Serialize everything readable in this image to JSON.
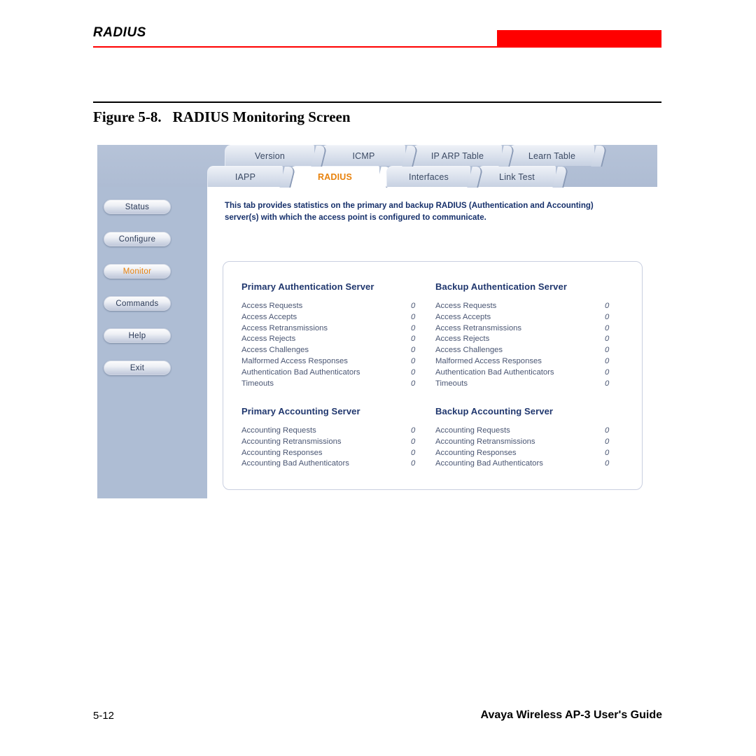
{
  "header": {
    "title": "RADIUS",
    "accent_color": "#ff0000"
  },
  "caption": {
    "figure_number": "Figure 5-8.",
    "figure_title": "RADIUS Monitoring Screen"
  },
  "screenshot": {
    "tabs_top": [
      {
        "label": "Version",
        "active": false
      },
      {
        "label": "ICMP",
        "active": false
      },
      {
        "label": "IP ARP Table",
        "active": false
      },
      {
        "label": "Learn Table",
        "active": false
      }
    ],
    "tabs_bottom": [
      {
        "label": "IAPP",
        "active": false
      },
      {
        "label": "RADIUS",
        "active": true
      },
      {
        "label": "Interfaces",
        "active": false
      },
      {
        "label": "Link Test",
        "active": false
      }
    ],
    "sidebar": {
      "buttons": [
        {
          "label": "Status",
          "active": false
        },
        {
          "label": "Configure",
          "active": false
        },
        {
          "label": "Monitor",
          "active": true
        },
        {
          "label": "Commands",
          "active": false
        },
        {
          "label": "Help",
          "active": false
        },
        {
          "label": "Exit",
          "active": false
        }
      ]
    },
    "intro_text": "This tab provides statistics on the primary and backup RADIUS (Authentication and Accounting) server(s) with which the access point is configured to communicate.",
    "refresh_icon": "refresh-icon",
    "active_tab_color": "#e8820c",
    "stats": {
      "primary_auth": {
        "title": "Primary Authentication Server",
        "rows": [
          {
            "label": "Access Requests",
            "value": "0"
          },
          {
            "label": "Access Accepts",
            "value": "0"
          },
          {
            "label": "Access Retransmissions",
            "value": "0"
          },
          {
            "label": "Access Rejects",
            "value": "0"
          },
          {
            "label": "Access Challenges",
            "value": "0"
          },
          {
            "label": "Malformed Access Responses",
            "value": "0"
          },
          {
            "label": "Authentication Bad Authenticators",
            "value": "0"
          },
          {
            "label": "Timeouts",
            "value": "0"
          }
        ]
      },
      "backup_auth": {
        "title": "Backup Authentication Server",
        "rows": [
          {
            "label": "Access Requests",
            "value": "0"
          },
          {
            "label": "Access Accepts",
            "value": "0"
          },
          {
            "label": "Access Retransmissions",
            "value": "0"
          },
          {
            "label": "Access Rejects",
            "value": "0"
          },
          {
            "label": "Access Challenges",
            "value": "0"
          },
          {
            "label": "Malformed Access Responses",
            "value": "0"
          },
          {
            "label": "Authentication Bad Authenticators",
            "value": "0"
          },
          {
            "label": "Timeouts",
            "value": "0"
          }
        ]
      },
      "primary_acct": {
        "title": "Primary Accounting Server",
        "rows": [
          {
            "label": "Accounting Requests",
            "value": "0"
          },
          {
            "label": "Accounting Retransmissions",
            "value": "0"
          },
          {
            "label": "Accounting Responses",
            "value": "0"
          },
          {
            "label": "Accounting Bad Authenticators",
            "value": "0"
          }
        ]
      },
      "backup_acct": {
        "title": "Backup Accounting Server",
        "rows": [
          {
            "label": "Accounting Requests",
            "value": "0"
          },
          {
            "label": "Accounting Retransmissions",
            "value": "0"
          },
          {
            "label": "Accounting Responses",
            "value": "0"
          },
          {
            "label": "Accounting Bad Authenticators",
            "value": "0"
          }
        ]
      }
    }
  },
  "footer": {
    "page_number": "5-12",
    "guide_title": "Avaya Wireless AP-3 User's Guide"
  }
}
